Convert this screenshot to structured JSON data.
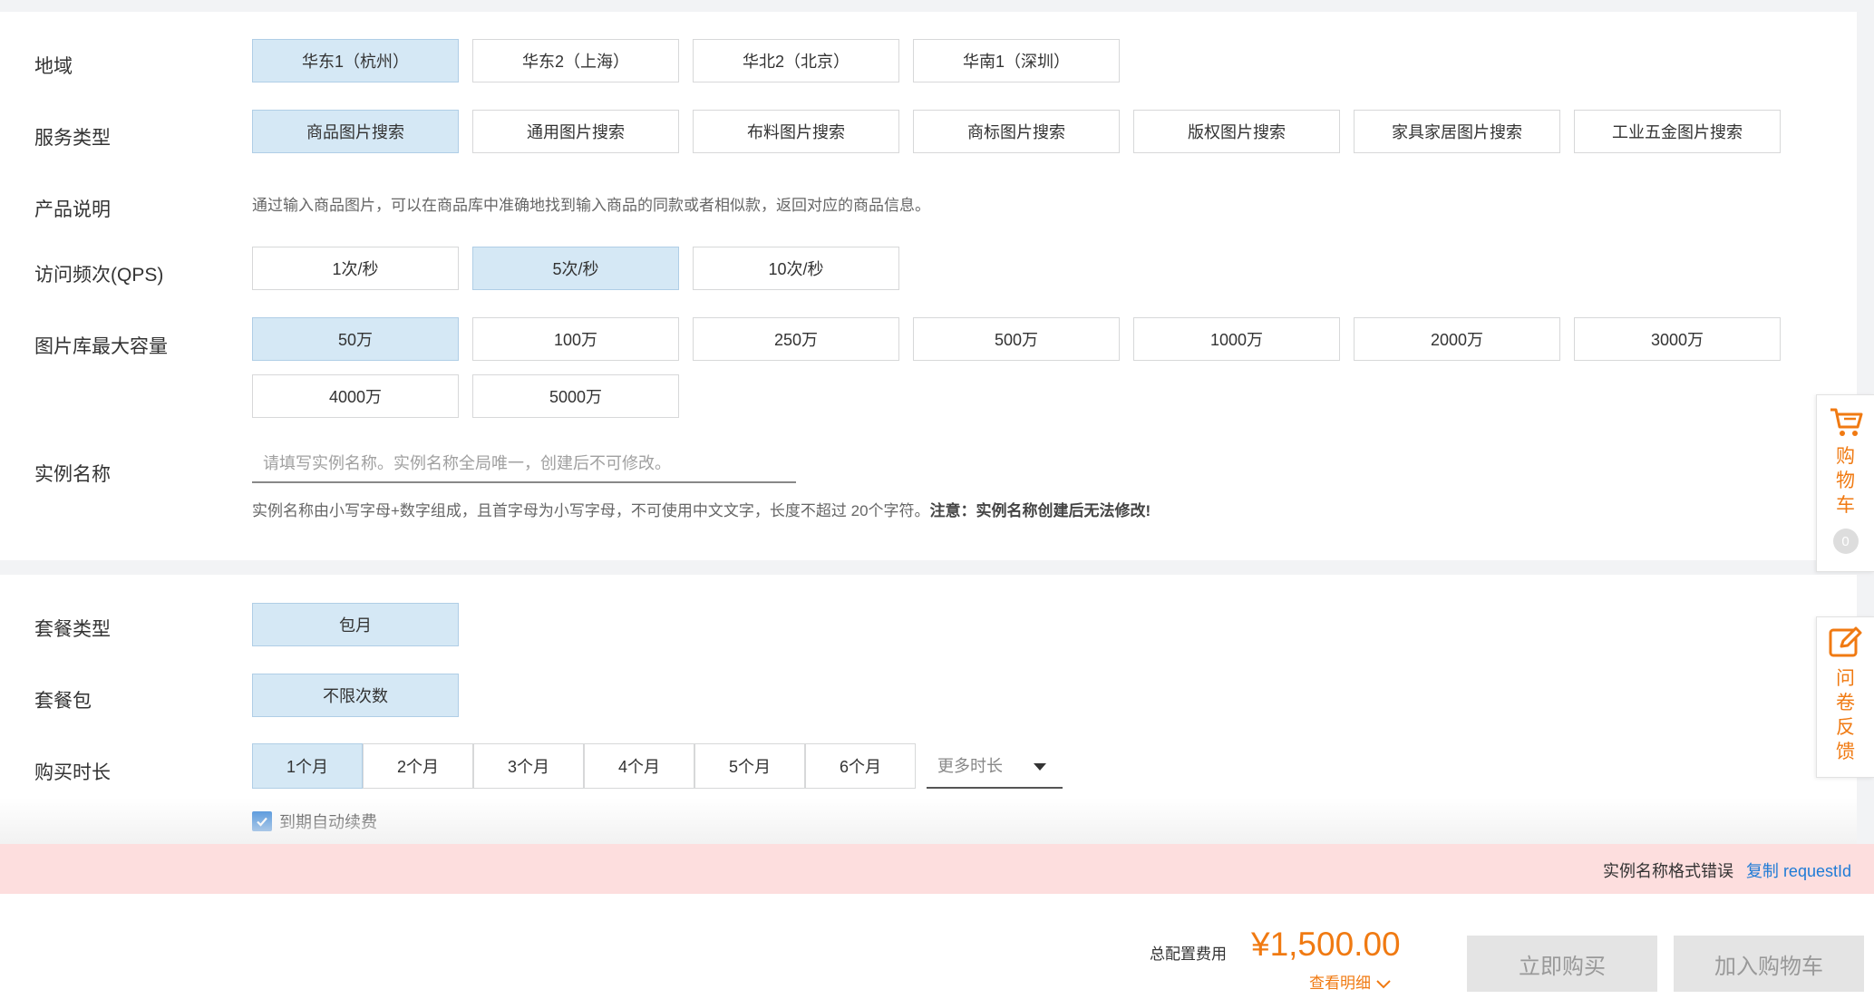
{
  "region": {
    "label": "地域",
    "options": [
      "华东1（杭州）",
      "华东2（上海）",
      "华北2（北京）",
      "华南1（深圳）"
    ],
    "selected": "华东1（杭州）"
  },
  "service_type": {
    "label": "服务类型",
    "options": [
      "商品图片搜索",
      "通用图片搜索",
      "布料图片搜索",
      "商标图片搜索",
      "版权图片搜索",
      "家具家居图片搜索",
      "工业五金图片搜索"
    ],
    "selected": "商品图片搜索"
  },
  "product_desc": {
    "label": "产品说明",
    "text": "通过输入商品图片，可以在商品库中准确地找到输入商品的同款或者相似款，返回对应的商品信息。"
  },
  "qps": {
    "label": "访问频次(QPS)",
    "options": [
      "1次/秒",
      "5次/秒",
      "10次/秒"
    ],
    "selected": "5次/秒"
  },
  "capacity": {
    "label": "图片库最大容量",
    "options": [
      "50万",
      "100万",
      "250万",
      "500万",
      "1000万",
      "2000万",
      "3000万",
      "4000万",
      "5000万"
    ],
    "selected": "50万"
  },
  "instance_name": {
    "label": "实例名称",
    "placeholder": "请填写实例名称。实例名称全局唯一，创建后不可修改。",
    "value": "",
    "hint": "实例名称由小写字母+数字组成，且首字母为小写字母，不可使用中文文字，长度不超过 20个字符。",
    "hint_warning": "注意：实例名称创建后无法修改!"
  },
  "package_type": {
    "label": "套餐类型",
    "options": [
      "包月"
    ],
    "selected": "包月"
  },
  "package": {
    "label": "套餐包",
    "options": [
      "不限次数"
    ],
    "selected": "不限次数"
  },
  "duration": {
    "label": "购买时长",
    "options": [
      "1个月",
      "2个月",
      "3个月",
      "4个月",
      "5个月",
      "6个月"
    ],
    "selected": "1个月",
    "more_label": "更多时长"
  },
  "auto_renew": {
    "label": "到期自动续费",
    "checked": true
  },
  "error_bar": {
    "message": "实例名称格式错误",
    "copy_link": "复制 requestId"
  },
  "footer": {
    "fee_label": "总配置费用",
    "fee_value": "¥1,500.00",
    "details_label": "查看明细",
    "buy_now": "立即购买",
    "add_cart": "加入购物车"
  },
  "float_cart": {
    "label": "购物车",
    "count": "0"
  },
  "float_survey": {
    "label": "问卷反馈"
  },
  "colors": {
    "accent": "#f07a12",
    "selected_bg": "#d5e8f5",
    "link": "#1e7bd6",
    "error_bg": "#fddede"
  }
}
